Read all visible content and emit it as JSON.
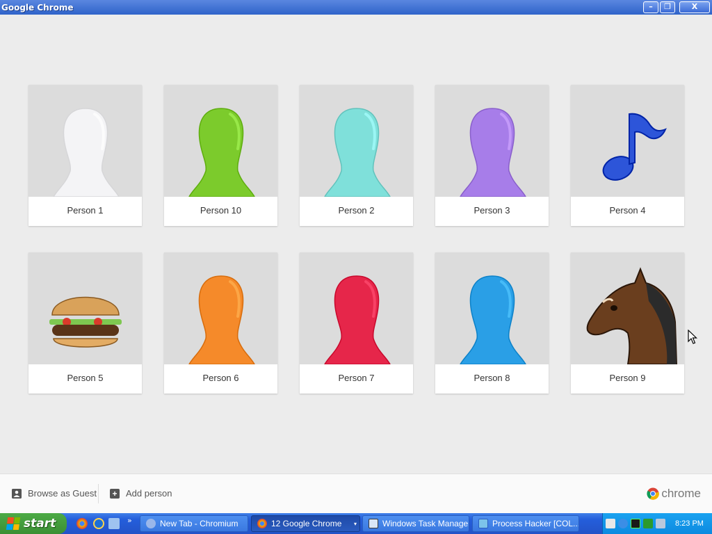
{
  "window": {
    "title": "Google Chrome",
    "minimize_label": "–",
    "maximize_label": "❐",
    "close_label": "X"
  },
  "profiles": [
    {
      "name": "Person 1",
      "avatar": "generic-person-icon",
      "color": "#f4f4f6"
    },
    {
      "name": "Person 10",
      "avatar": "generic-person-icon",
      "color": "#7ccb2c"
    },
    {
      "name": "Person 2",
      "avatar": "generic-person-icon",
      "color": "#7fe0da"
    },
    {
      "name": "Person 3",
      "avatar": "generic-person-icon",
      "color": "#a77de9"
    },
    {
      "name": "Person 4",
      "avatar": "music-note-icon",
      "color": "#2d55d9"
    },
    {
      "name": "Person 5",
      "avatar": "hamburger-icon",
      "color": "#d9a25a"
    },
    {
      "name": "Person 6",
      "avatar": "generic-person-icon",
      "color": "#f58a2a"
    },
    {
      "name": "Person 7",
      "avatar": "generic-person-icon",
      "color": "#e6264a"
    },
    {
      "name": "Person 8",
      "avatar": "generic-person-icon",
      "color": "#2a9fe6"
    },
    {
      "name": "Person 9",
      "avatar": "horse-icon",
      "color": "#6a3e1e"
    }
  ],
  "bottom_bar": {
    "guest_label": "Browse as Guest",
    "add_person_label": "Add person",
    "brand_label": "chrome"
  },
  "taskbar": {
    "start_label": "start",
    "more_label": "»",
    "tasks": [
      {
        "label": "New Tab - Chromium",
        "active": false
      },
      {
        "label": "12 Google Chrome",
        "active": true
      },
      {
        "label": "Windows Task Manager",
        "active": false
      },
      {
        "label": "Process Hacker [COL...",
        "active": false
      }
    ],
    "clock": "8:23 PM"
  },
  "colors": {
    "titlebar": "#2f63c9",
    "taskbar": "#245edb",
    "start": "#3b8f34",
    "page_bg": "#ececec"
  }
}
